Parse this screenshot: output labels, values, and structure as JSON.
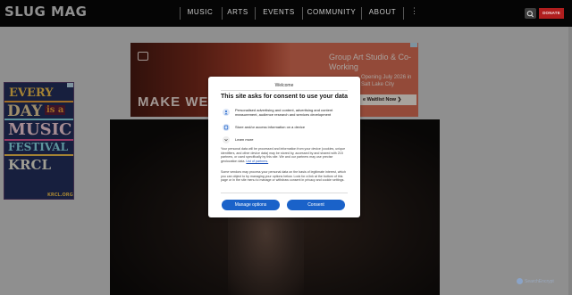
{
  "header": {
    "logo": "SLUG MAG",
    "nav": [
      {
        "label": "MUSIC"
      },
      {
        "label": "ARTS"
      },
      {
        "label": "EVENTS"
      },
      {
        "label": "COMMUNITY"
      },
      {
        "label": "ABOUT"
      }
    ],
    "more_label": "⋮",
    "donate_label": "DONATE",
    "colors": {
      "background": "#050505",
      "donate": "#b01e1e"
    }
  },
  "left_ad": {
    "lines": [
      "EVERY",
      "DAY",
      "is a",
      "MUSIC",
      "FESTIVAL",
      "KRCL"
    ],
    "url": "KRCL.ORG"
  },
  "banner_ad": {
    "headline": "MAKE WE",
    "title": "Group Art Studio & Co-Working",
    "subtitle": "Opening July 2026 in Salt Lake City",
    "cta": "e Waitlist Now  ❯"
  },
  "consent_dialog": {
    "welcome": "Welcome",
    "title": "This site asks for consent to use your data",
    "purposes": [
      {
        "icon": "person-icon",
        "text": "Personalised advertising and content, advertising and content measurement, audience research and services development"
      },
      {
        "icon": "device-icon",
        "text": "Store and/or access information on a device"
      }
    ],
    "learn_more": "Learn more",
    "body_1": "Your personal data will be processed and information from your device (cookies, unique identifiers, and other device data) may be stored by, accessed by and shared with 215 partners, or used specifically by this site. We and our partners may use precise geolocation data.",
    "partners_link": "List of partners.",
    "body_2": "Some vendors may process your personal data on the basis of legitimate interest, which you can object to by managing your options below. Look for a link at the bottom of this page or in the site menu to manage or withdraw consent in privacy and cookie settings.",
    "manage_label": "Manage options",
    "consent_label": "Consent",
    "button_color": "#1a62c9"
  },
  "watermark": "SearchEncrypt"
}
